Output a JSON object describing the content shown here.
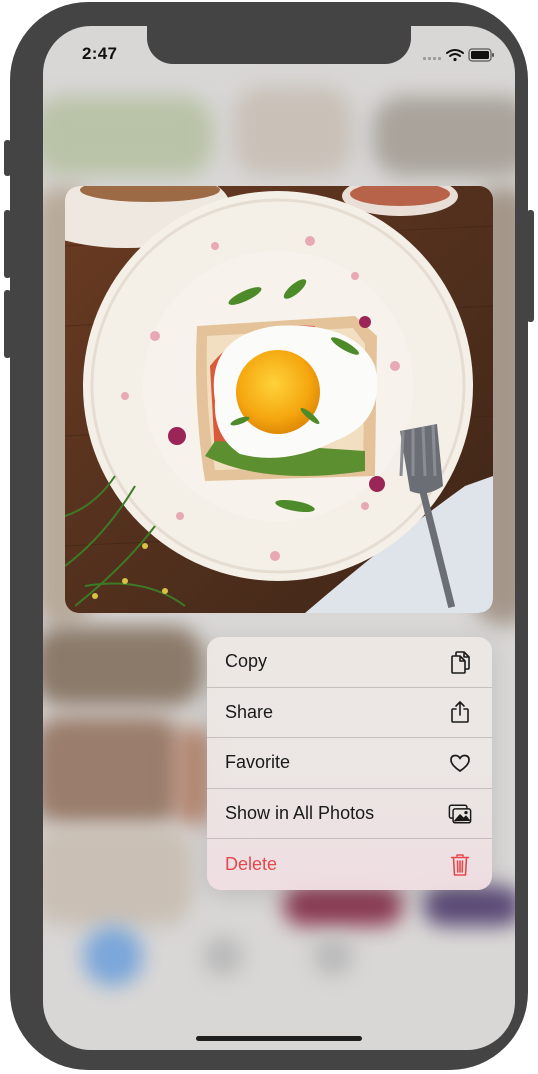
{
  "status_bar": {
    "time": "2:47",
    "icons": [
      "cellular-signal-icon",
      "wifi-icon",
      "battery-icon"
    ]
  },
  "photo": {
    "subject": "fried egg toast on floral plate"
  },
  "context_menu": {
    "items": [
      {
        "label": "Copy",
        "icon": "copy-icon"
      },
      {
        "label": "Share",
        "icon": "share-icon"
      },
      {
        "label": "Favorite",
        "icon": "heart-icon"
      },
      {
        "label": "Show in All Photos",
        "icon": "photos-icon"
      },
      {
        "label": "Delete",
        "icon": "trash-icon",
        "destructive": true
      }
    ]
  },
  "colors": {
    "destructive": "#e5484d",
    "device_frame": "#444444"
  }
}
